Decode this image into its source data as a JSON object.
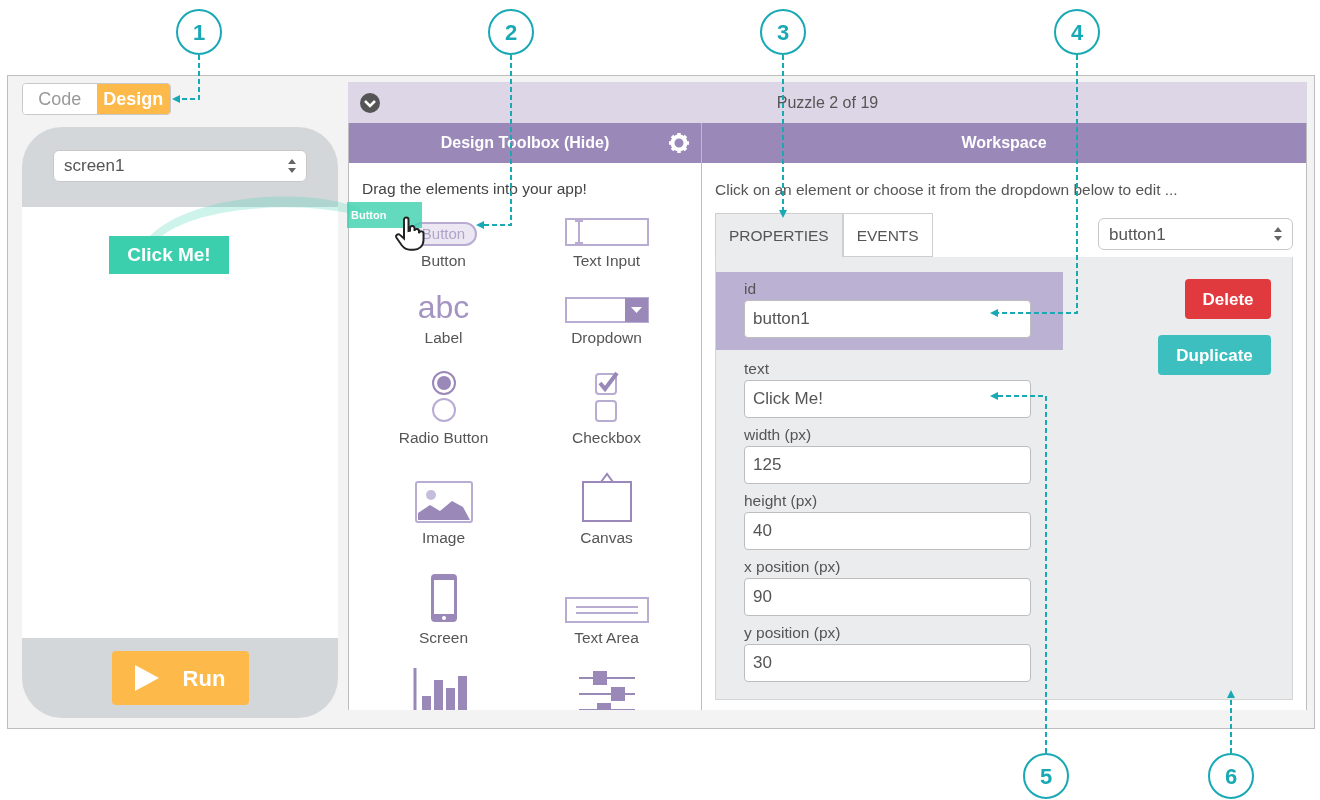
{
  "callouts": [
    "1",
    "2",
    "3",
    "4",
    "5",
    "6"
  ],
  "mode_toggle": [
    {
      "label": "Code",
      "selected": false
    },
    {
      "label": "Design",
      "selected": true
    }
  ],
  "phone": {
    "screen_select": "screen1",
    "app_button": "Click Me!",
    "run_button": "Run"
  },
  "drag_ghost": "Button",
  "puzzle_bar": {
    "title": "Puzzle 2 of 19"
  },
  "toolbox": {
    "title": "Design Toolbox (Hide)",
    "hint": "Drag the elements into your app!",
    "items": [
      {
        "kind": "button",
        "label": "Button",
        "icon_text": "Button"
      },
      {
        "kind": "text_input",
        "label": "Text Input"
      },
      {
        "kind": "label",
        "label": "Label",
        "icon_text": "abc"
      },
      {
        "kind": "dropdown",
        "label": "Dropdown"
      },
      {
        "kind": "radio",
        "label": "Radio Button"
      },
      {
        "kind": "checkbox",
        "label": "Checkbox"
      },
      {
        "kind": "image",
        "label": "Image"
      },
      {
        "kind": "canvas",
        "label": "Canvas"
      },
      {
        "kind": "screen",
        "label": "Screen"
      },
      {
        "kind": "text_area",
        "label": "Text Area"
      },
      {
        "kind": "chart"
      },
      {
        "kind": "slider"
      }
    ]
  },
  "workspace": {
    "title": "Workspace",
    "hint": "Click on an element or choose it from the dropdown below to edit ...",
    "tabs": [
      {
        "label": "PROPERTIES",
        "selected": true
      },
      {
        "label": "EVENTS",
        "selected": false
      }
    ],
    "element_select": "button1",
    "fields": [
      {
        "label": "id",
        "value": "button1",
        "selected": true
      },
      {
        "label": "text",
        "value": "Click Me!",
        "selected": false
      },
      {
        "label": "width (px)",
        "value": "125",
        "selected": false
      },
      {
        "label": "height (px)",
        "value": "40",
        "selected": false
      },
      {
        "label": "x position (px)",
        "value": "90",
        "selected": false
      },
      {
        "label": "y position (px)",
        "value": "30",
        "selected": false
      }
    ],
    "delete_button": "Delete",
    "duplicate_button": "Duplicate"
  }
}
